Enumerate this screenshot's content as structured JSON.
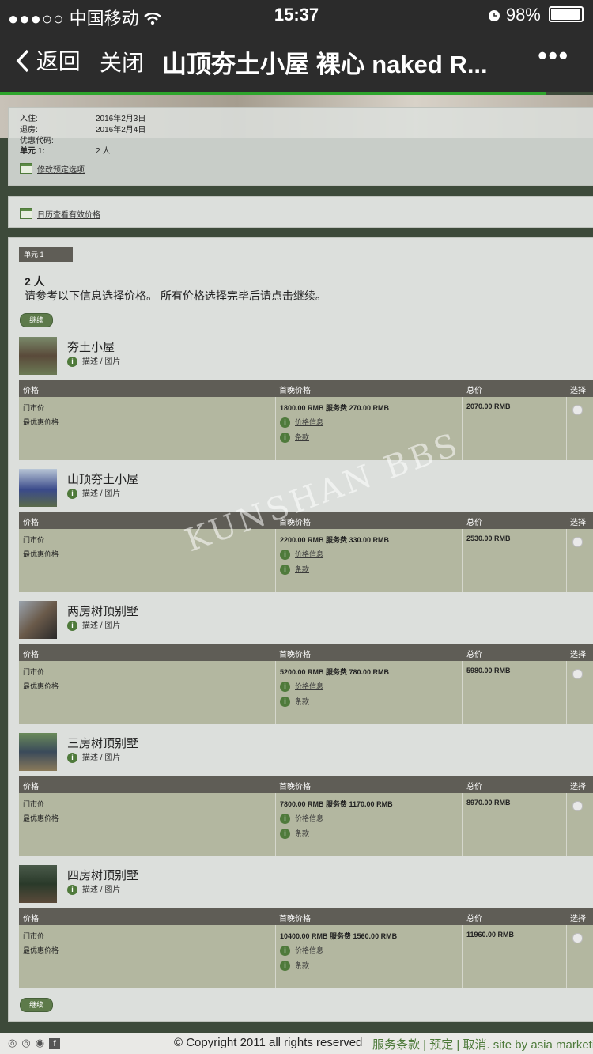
{
  "status_bar": {
    "signal": "●●●○○",
    "carrier": "中国移动",
    "time": "15:37",
    "battery": "98%"
  },
  "nav": {
    "back": "返回",
    "close": "关闭",
    "title": "山顶夯土小屋 裸心 naked R...",
    "more": "•••"
  },
  "booking": {
    "checkin_label": "入住:",
    "checkin": "2016年2月3日",
    "checkout_label": "退房:",
    "checkout": "2016年2月4日",
    "promo_label": "优惠代码:",
    "unit_label": "单元 1:",
    "unit_value": "2 人",
    "modify_link": "修改预定选项"
  },
  "calendar_link": "日历查看有效价格",
  "unit_tab": "单元 1",
  "people": "2 人",
  "instructions": "请参考以下信息选择价格。  所有价格选择完毕后请点击继续。",
  "continue_label": "继续",
  "table_headers": {
    "price": "价格",
    "first_night": "首晚价格",
    "total": "总价",
    "select": "选择"
  },
  "rate_labels": {
    "door": "门市价",
    "best": "最优惠价格"
  },
  "links": {
    "desc": "描述 / 图片",
    "price_info": "价格信息",
    "terms": "条款"
  },
  "rooms": [
    {
      "name": "夯土小屋",
      "first_night": "1800.00 RMB 服务费 270.00 RMB",
      "total": "2070.00 RMB"
    },
    {
      "name": "山顶夯土小屋",
      "first_night": "2200.00 RMB 服务费 330.00 RMB",
      "total": "2530.00 RMB"
    },
    {
      "name": "两房树顶别墅",
      "first_night": "5200.00 RMB 服务费 780.00 RMB",
      "total": "5980.00 RMB"
    },
    {
      "name": "三房树顶别墅",
      "first_night": "7800.00 RMB 服务费 1170.00 RMB",
      "total": "8970.00 RMB"
    },
    {
      "name": "四房树顶别墅",
      "first_night": "10400.00 RMB 服务费 1560.00 RMB",
      "total": "11960.00 RMB"
    }
  ],
  "watermark": "KUNSHAN BBS",
  "footer": {
    "copyright": "© Copyright 2011 all rights reserved",
    "links": "服务条款 | 预定 | 取消.   site by asia marketi"
  }
}
